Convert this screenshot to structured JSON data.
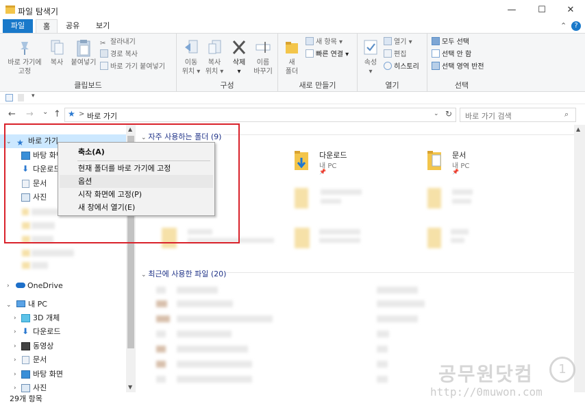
{
  "window": {
    "title": "파일 탐색기",
    "minimize": "—",
    "maximize": "☐",
    "close": "✕"
  },
  "tabs": [
    "파일",
    "홈",
    "공유",
    "보기"
  ],
  "ribbon": {
    "clipboard": {
      "pin_label_1": "바로 가기에",
      "pin_label_2": "고정",
      "copy": "복사",
      "paste": "붙여넣기",
      "cut": "잘라내기",
      "copy_path": "경로 복사",
      "paste_shortcut": "바로 가기 붙여넣기",
      "group": "클립보드"
    },
    "organize": {
      "move_1": "이동",
      "move_2": "위치 ▾",
      "copyto_1": "복사",
      "copyto_2": "위치 ▾",
      "delete": "삭제",
      "delete_arrow": "▾",
      "rename_1": "이름",
      "rename_2": "바꾸기",
      "group": "구성"
    },
    "new": {
      "folder_1": "새",
      "folder_2": "폴더",
      "new_item": "새 항목 ▾",
      "easy_access": "빠른 연결 ▾",
      "group": "새로 만들기"
    },
    "open": {
      "properties": "속성",
      "properties_arrow": "▾",
      "open": "열기 ▾",
      "edit": "편집",
      "history": "히스토리",
      "group": "열기"
    },
    "select": {
      "all": "모두 선택",
      "none": "선택 안 함",
      "invert": "선택 영역 반전",
      "group": "선택"
    },
    "collapse": "⌃",
    "help": "?"
  },
  "qat": {
    "dropdown": "▾"
  },
  "address": {
    "back": "←",
    "forward": "→",
    "recent": "⌄",
    "up": "↑",
    "sep": ">",
    "path": "바로 가기",
    "refresh": "↻",
    "chevron": "⌄",
    "search_placeholder": "바로 가기 검색"
  },
  "nav": {
    "quick_access": "바로 가기",
    "qa_items": [
      "바탕 화면",
      "다운로드",
      "문서",
      "사진"
    ],
    "onedrive": "OneDrive",
    "this_pc": "내 PC",
    "pc_items": [
      "3D 개체",
      "다운로드",
      "동영상",
      "문서",
      "바탕 화면",
      "사진"
    ]
  },
  "main": {
    "frequent_header": "자주 사용하는 폴더 (9)",
    "recent_header": "최근에 사용한 파일 (20)",
    "tiles": [
      {
        "name": "다운로드",
        "sub": "내 PC"
      },
      {
        "name": "문서",
        "sub": "내 PC"
      }
    ]
  },
  "context_menu": {
    "items": [
      "축소(A)",
      "현재 폴더를 바로 가기에 고정",
      "옵션",
      "시작 화면에 고정(P)",
      "새 창에서 열기(E)"
    ]
  },
  "status": {
    "count": "29개 항목"
  },
  "watermark": {
    "line1": "공무원닷컴",
    "line2": "http://0muwon.com"
  },
  "colors": {
    "accent": "#1979ca",
    "highlight": "#d9212a"
  }
}
